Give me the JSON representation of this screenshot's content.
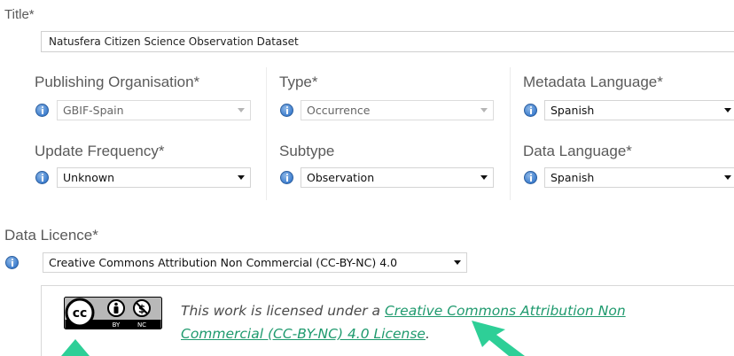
{
  "title_field": {
    "label": "Title*",
    "value": "Natusfera Citizen Science Observation Dataset"
  },
  "fields": {
    "publishing_org": {
      "label": "Publishing Organisation*",
      "value": "GBIF-Spain"
    },
    "type": {
      "label": "Type*",
      "value": "Occurrence"
    },
    "metadata_language": {
      "label": "Metadata Language*",
      "value": "Spanish"
    },
    "update_frequency": {
      "label": "Update Frequency*",
      "value": "Unknown"
    },
    "subtype": {
      "label": "Subtype",
      "value": "Observation"
    },
    "data_language": {
      "label": "Data Language*",
      "value": "Spanish"
    }
  },
  "data_licence": {
    "label": "Data Licence*",
    "value": "Creative Commons Attribution Non Commercial (CC-BY-NC) 4.0"
  },
  "licence_notice": {
    "prefix": "This work is licensed under a ",
    "link_line1": "Creative Commons Attribution Non",
    "link_line2": "Commercial (CC-BY-NC) 4.0 License",
    "suffix": ".",
    "badge_text_cc": "cc",
    "badge_text_by": "BY",
    "badge_text_nc": "NC"
  },
  "colors": {
    "link": "#1f9a6e",
    "info_icon": "#3f7fcf",
    "annotation_arrow": "#2ecf97"
  }
}
